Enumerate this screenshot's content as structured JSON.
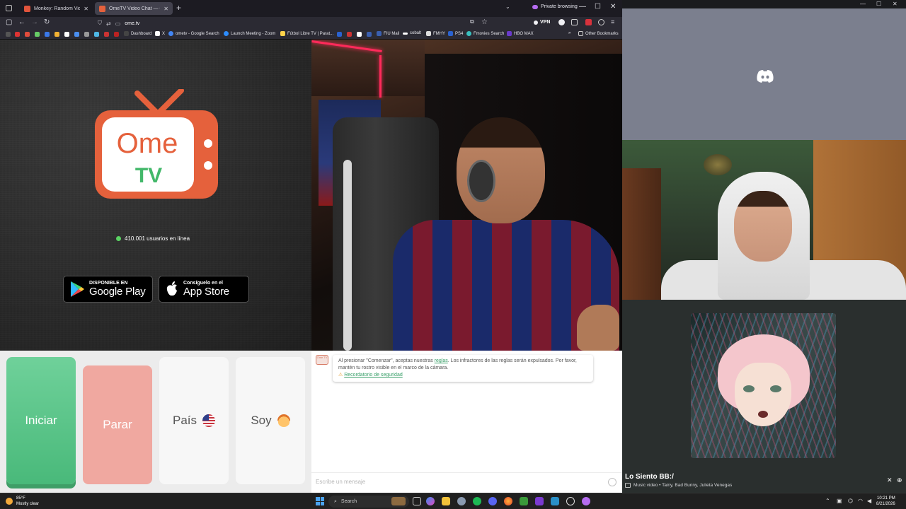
{
  "browser": {
    "tabs": [
      {
        "title": "Monkey: Random Video Chat |",
        "active": false,
        "favicon_color": "#e0543c"
      },
      {
        "title": "OmeTV Video Chat — Omegle",
        "active": true,
        "favicon_color": "#e5613c"
      }
    ],
    "new_tab_icon": "plus-icon",
    "private_label": "Private browsing",
    "window_controls": [
      "—",
      "☐",
      "✕"
    ],
    "url": "ome.tv",
    "vpn_label": "VPN",
    "bookmarks": [
      {
        "label": "Dashboard",
        "icon_color": "#ffffff"
      },
      {
        "label": "X",
        "icon_color": "#ffffff"
      },
      {
        "label": "ometv - Google Search",
        "icon_color": "#4285f4"
      },
      {
        "label": "Launch Meeting - Zoom",
        "icon_color": "#2d8cff"
      },
      {
        "label": "Fútbol Libre TV | Parat...",
        "icon_color": "#ffd24a"
      },
      {
        "label": "FIU Mail",
        "icon_color": "#3a5fb0"
      },
      {
        "label": "cobalt",
        "icon_color": "#ffffff"
      },
      {
        "label": "FMHY",
        "icon_color": "#ffffff"
      },
      {
        "label": "PS4",
        "icon_color": "#2a62d0"
      },
      {
        "label": "Fmovies Search",
        "icon_color": "#39c0c0"
      },
      {
        "label": "HBO MAX",
        "icon_color": "#6a3acb"
      }
    ],
    "other_bookmarks": "Other Bookmarks"
  },
  "ometv": {
    "logo_text_top": "Ome",
    "logo_text_bottom": "TV",
    "online_count": "410.001 usuarios en línea",
    "google_play_small": "DISPONIBLE EN",
    "google_play_big": "Google Play",
    "app_store_small": "Consíguelo en el",
    "app_store_big": "App Store",
    "btn_start": "Iniciar",
    "btn_stop": "Parar",
    "btn_country": "País",
    "btn_sex": "Soy",
    "notice_pre": "Al presionar \"Comenzar\", aceptas nuestras ",
    "notice_link": "reglas",
    "notice_post": ". Los infractores de las reglas serán expulsados. Por favor, mantén tu rostro visible en el marco de la cámara.",
    "safety_link": "Recordatorio de seguridad",
    "message_placeholder": "Escribe un mensaje",
    "brand_colors": {
      "accent": "#e5613c",
      "green": "#5ad363",
      "start": "#5ac48a",
      "stop": "#f0a8a0"
    }
  },
  "discord": {
    "logo_icon": "discord-icon",
    "bg": "#7b7f8e"
  },
  "music": {
    "title": "Lo Siento BB:/",
    "meta": "Music video • Tainy, Bad Bunny, Julieta Venegas"
  },
  "taskbar": {
    "weather_temp": "85°F",
    "weather_desc": "Mostly clear",
    "search_placeholder": "Search",
    "time": "10:21 PM",
    "date": "8/21/2026"
  }
}
